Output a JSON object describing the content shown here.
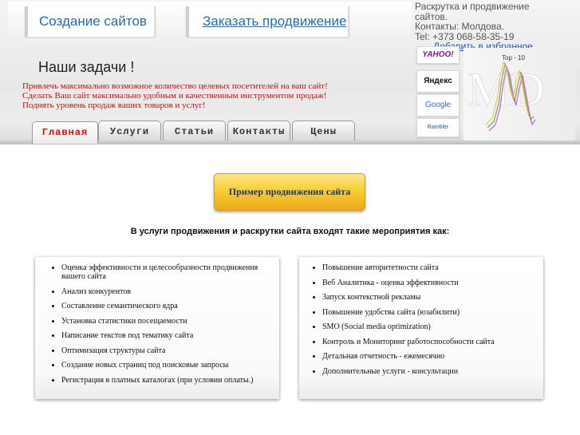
{
  "header": {
    "nav_links": [
      "Создание сайтов",
      "Заказать продвижение"
    ],
    "contact": {
      "lines": [
        "Раскрутка и продвижение",
        "сайтов.",
        "Контакты: Молдова.",
        "Tel: +373 068-58-35-19"
      ],
      "favorite_link": "Добавить в избранное"
    },
    "tasks_title": "Наши задачи !",
    "tasks": [
      "Привлечь максимально возможное количество целевых посетителей на ваш сайт!",
      "Сделать Ваш сайт максимально удобным и качественным инструментом продаж!",
      "Поднять уровень продаж ваших товаров и услуг!"
    ],
    "logos": [
      "YAHOO!",
      "Яндекс",
      "Google",
      "Rambler"
    ],
    "graph_label": "Top - 10"
  },
  "tabs": [
    {
      "label": "Главная",
      "active": true
    },
    {
      "label": "Услуги",
      "active": false
    },
    {
      "label": "Статьи",
      "active": false
    },
    {
      "label": "Контакты",
      "active": false
    },
    {
      "label": "Цены",
      "active": false
    }
  ],
  "main": {
    "promo_button": "Пример продвижения сайта",
    "subtitle": "В услуги продвижения и раскрутки сайта входят такие мероприятия как:",
    "left_list": [
      "Оценка эффективности и целесообразности продвижения вашего сайта",
      "Анализ конкурентов",
      "Составление семантического ядра",
      "Установка статистики посещаемости",
      "Написание текстов под тематику сайта",
      "Оптимизация структуры сайта",
      "Создание новых страниц под поисковые запросы",
      "Регистрация в платных каталогах (при условии оплаты.)"
    ],
    "right_list": [
      "Повышение авторитетности сайта",
      "Веб Аналитика - оценка эффективности",
      "Запуск контекстной рекламы",
      "Повышение удобства сайта (юзабилити)",
      "SMO (Social media optimization)",
      "Контроль и Мониторинг работоспособности сайта",
      "Детальная отчетность - ежемесячно",
      "Дополнительные услуги - консультации"
    ]
  },
  "colors": {
    "link_blue": "#2a6aa5",
    "task_red": "#c01010",
    "button_gold": "#f8ce35",
    "button_text": "#1d3870"
  }
}
